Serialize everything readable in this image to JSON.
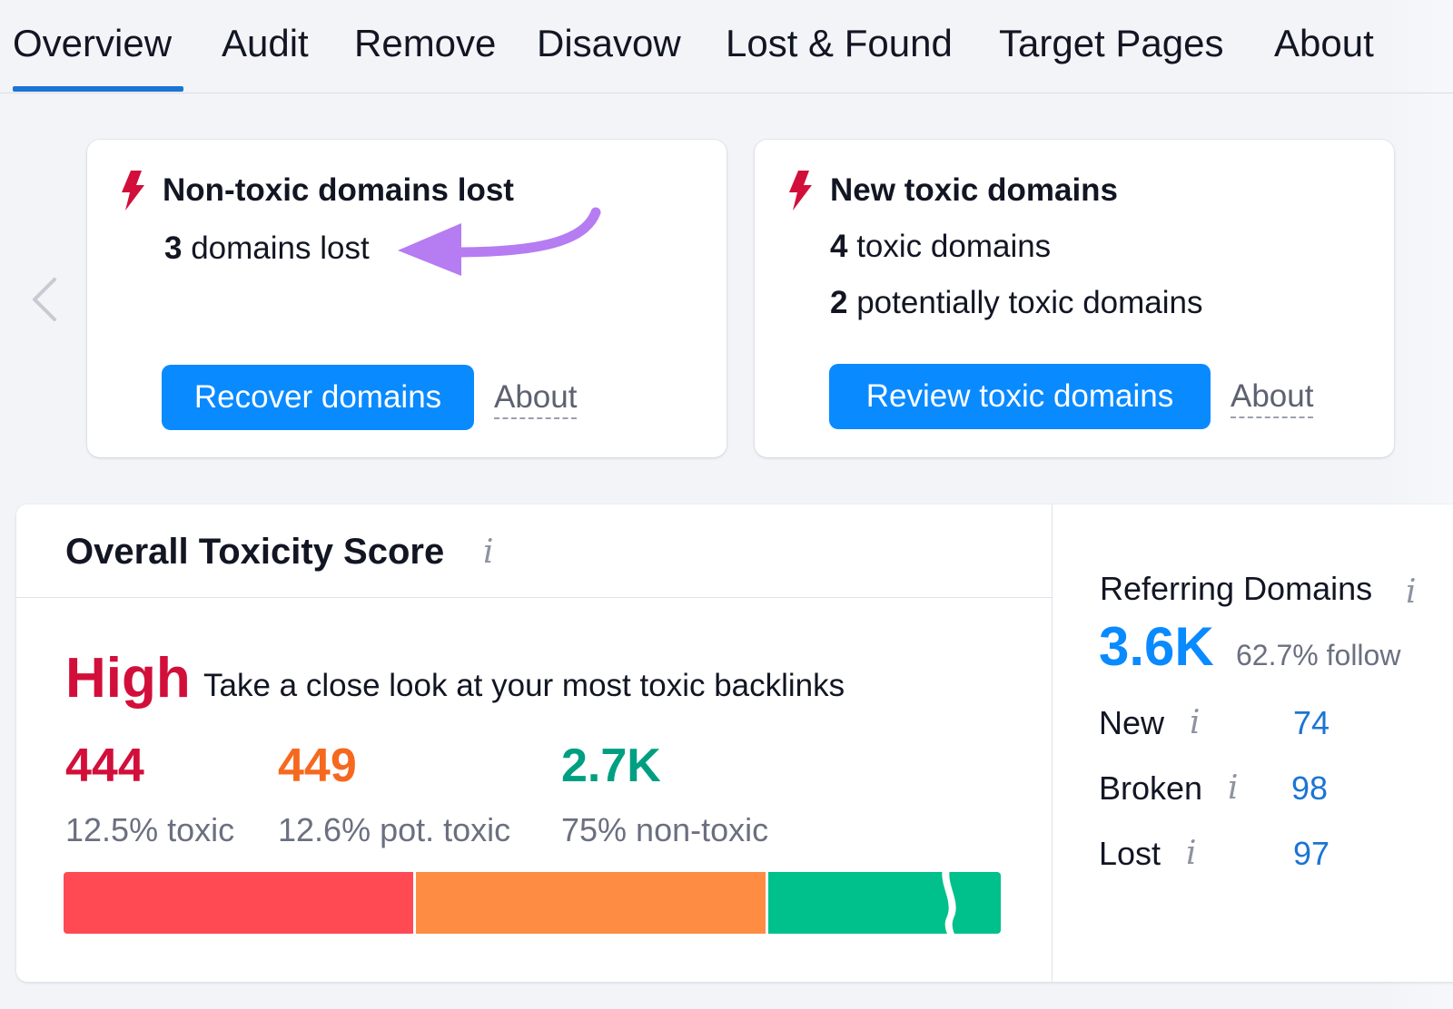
{
  "tabs": [
    {
      "label": "Overview",
      "active": true
    },
    {
      "label": "Audit"
    },
    {
      "label": "Remove"
    },
    {
      "label": "Disavow"
    },
    {
      "label": "Lost & Found"
    },
    {
      "label": "Target Pages"
    },
    {
      "label": "About"
    }
  ],
  "cards": [
    {
      "title": "Non-toxic domains lost",
      "lines": [
        {
          "count": "3",
          "text": "domains lost"
        }
      ],
      "button": "Recover domains",
      "about": "About"
    },
    {
      "title": "New toxic domains",
      "lines": [
        {
          "count": "4",
          "text": "toxic domains"
        },
        {
          "count": "2",
          "text": "potentially toxic domains"
        }
      ],
      "button": "Review toxic domains",
      "about": "About"
    }
  ],
  "toxicity": {
    "title": "Overall Toxicity Score",
    "level": "High",
    "description": "Take a close look at your most toxic backlinks",
    "stats": [
      {
        "value": "444",
        "label": "12.5% toxic",
        "color": "#d20f3a"
      },
      {
        "value": "449",
        "label": "12.6% pot. toxic",
        "color": "#f5691f"
      },
      {
        "value": "2.7K",
        "label": "75% non-toxic",
        "color": "#009f81"
      }
    ],
    "bar": [
      {
        "name": "toxic",
        "share": 0.375,
        "color": "#ff4953"
      },
      {
        "name": "potentially-toxic",
        "share": 0.375,
        "color": "#ff8c43"
      },
      {
        "name": "non-toxic",
        "share": 0.25,
        "color": "#00c08b"
      }
    ]
  },
  "referring": {
    "title": "Referring Domains",
    "total": "3.6K",
    "follow": "62.7% follow",
    "rows": [
      {
        "label": "New",
        "value": "74"
      },
      {
        "label": "Broken",
        "value": "98"
      },
      {
        "label": "Lost",
        "value": "97"
      }
    ]
  },
  "colors": {
    "accent": "#0a8aff",
    "bolt": "#d20f3a",
    "arrow": "#b67cf2"
  },
  "icons": {
    "bolt": "lightning-bolt-icon",
    "info": "info-icon",
    "prev": "chevron-left-icon"
  }
}
